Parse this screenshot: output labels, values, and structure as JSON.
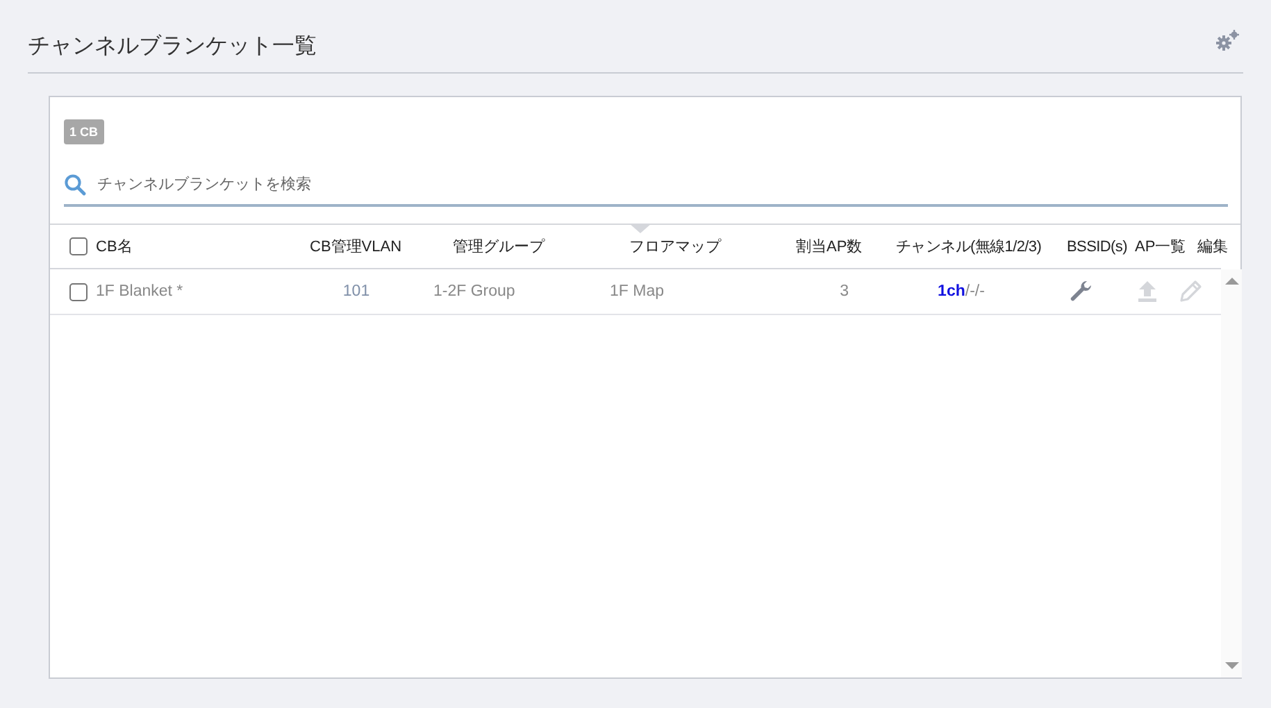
{
  "page": {
    "title": "チャンネルブランケット一覧"
  },
  "count_badge": "1 CB",
  "search": {
    "placeholder": "チャンネルブランケットを検索"
  },
  "table": {
    "select_all": {
      "checked": false
    },
    "columns": [
      {
        "label": "CB名",
        "sorted": false
      },
      {
        "label": "CB管理VLAN",
        "sorted": false
      },
      {
        "label": "管理グループ",
        "sorted": false
      },
      {
        "label": "フロアマップ",
        "sorted": true
      },
      {
        "label": "割当AP数",
        "sorted": false
      },
      {
        "label": "チャンネル(無線1/2/3)",
        "sorted": false
      },
      {
        "label": "BSSID(s)",
        "sorted": false
      },
      {
        "label": "AP一覧",
        "sorted": false
      },
      {
        "label": "編集",
        "sorted": false
      }
    ],
    "rows": [
      {
        "checked": false,
        "name": "1F Blanket *",
        "vlan": "101",
        "group": "1-2F Group",
        "floor_map": "1F Map",
        "ap_count": "3",
        "channel": "**1ch**/-/-",
        "actions": [
          {
            "disabled": false
          },
          {
            "disabled": true
          },
          {
            "disabled": true
          }
        ]
      }
    ]
  }
}
